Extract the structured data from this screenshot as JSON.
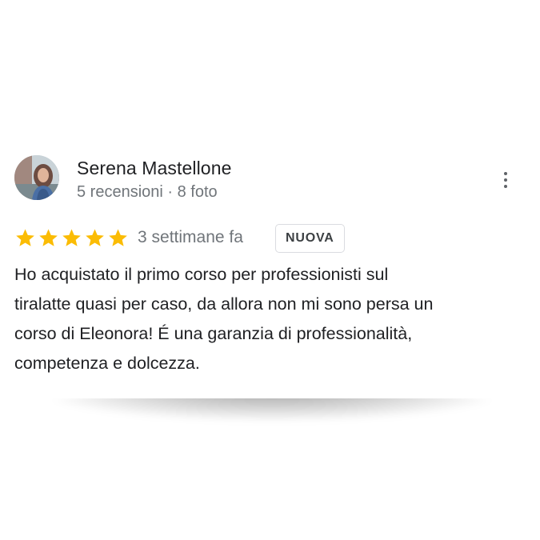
{
  "review": {
    "author_name": "Serena Mastellone",
    "author_meta": "5 recensioni · 8 foto",
    "rating": 5,
    "rating_max": 5,
    "time_ago": "3 settimane fa",
    "badge": "NUOVA",
    "text_lines": [
      "Ho acquistato il primo corso per professionisti sul",
      "tiralatte quasi per caso, da allora non mi sono persa un",
      "corso di Eleonora! É una garanzia di professionalità,",
      "competenza e dolcezza."
    ],
    "star_color": "#fbbc04",
    "more_icon": "more-vert-icon"
  }
}
